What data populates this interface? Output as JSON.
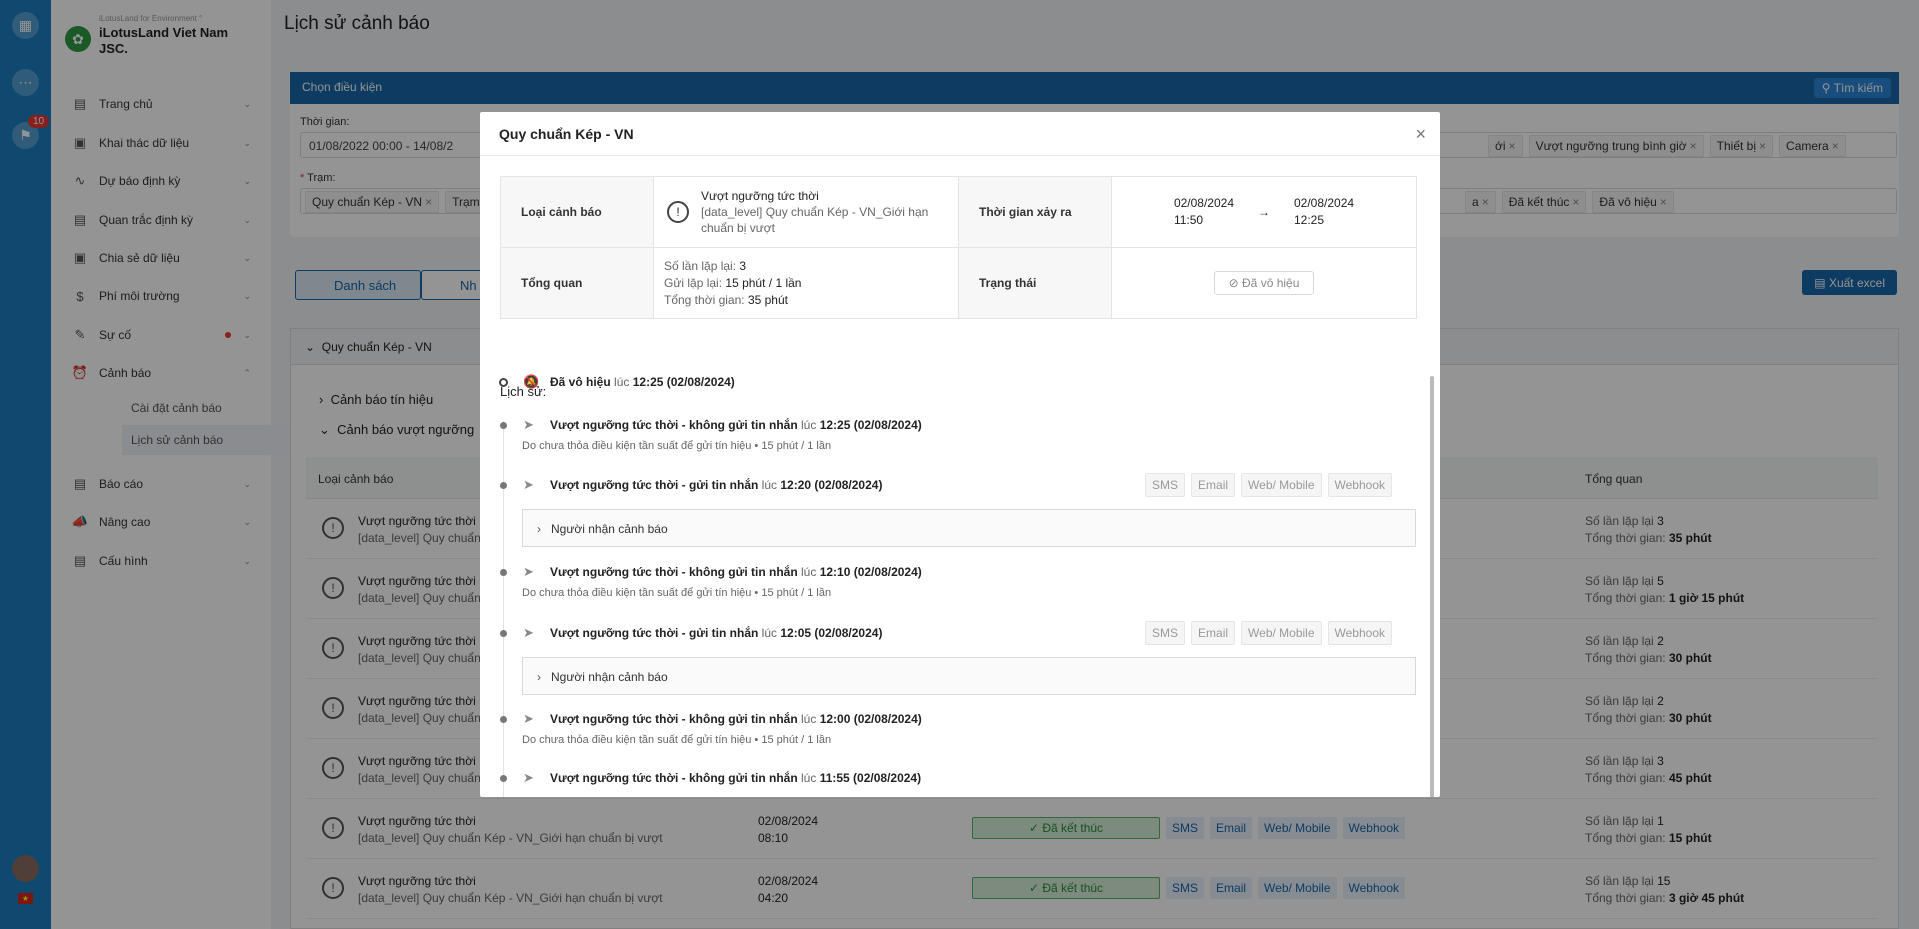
{
  "rail": {
    "badge": "10"
  },
  "brand": {
    "tagline": "iLotusLand for Environment °",
    "name": "iLotusLand Viet Nam JSC."
  },
  "nav": [
    {
      "label": "Trang chủ"
    },
    {
      "label": "Khai thác dữ liệu"
    },
    {
      "label": "Dự báo định kỳ"
    },
    {
      "label": "Quan trắc định kỳ"
    },
    {
      "label": "Chia sẻ dữ liệu"
    },
    {
      "label": "Phí môi trường"
    },
    {
      "label": "Sự cố"
    },
    {
      "label": "Cảnh báo"
    },
    {
      "label": "Báo cáo"
    },
    {
      "label": "Nâng cao"
    },
    {
      "label": "Cấu hình"
    }
  ],
  "subnav": {
    "settings": "Cài đặt cảnh báo",
    "history": "Lịch sử cảnh báo"
  },
  "page": {
    "title": "Lịch sử cảnh báo"
  },
  "filter": {
    "header": "Chọn điều kiện",
    "search": "Tìm kiếm",
    "time_label": "Thời gian:",
    "time_value": "01/08/2022 00:00 - 14/08/2",
    "station_label": "Trạm:",
    "type_tags": [
      "ới",
      "Vượt ngưỡng trung bình giờ",
      "Thiết bị",
      "Camera"
    ],
    "station_tags": [
      "Quy chuẩn Kép - VN",
      "Trạm"
    ],
    "status_tags": [
      "a",
      "Đã kết thúc",
      "Đã vô hiệu"
    ]
  },
  "tabs": {
    "list": "Danh sách",
    "other": "Nh"
  },
  "export": "Xuất excel",
  "group": {
    "title": "Quy chuẩn Kép - VN",
    "sec_signal": "Cảnh báo tín hiệu",
    "sec_threshold": "Cảnh báo vượt ngưỡng",
    "col_type": "Loại cảnh báo",
    "col_summary": "Tổng quan",
    "repeat_label": "Số lần lặp lại",
    "total_label": "Tổng thời gian:",
    "rows": [
      {
        "title": "Vượt ngưỡng tức thời",
        "desc": "[data_level] Quy chuẩn",
        "date": "",
        "time": "",
        "status": "",
        "repeat": "3",
        "total": "35 phút"
      },
      {
        "title": "Vượt ngưỡng tức thời",
        "desc": "[data_level] Quy chuẩn",
        "date": "",
        "time": "",
        "status": "",
        "repeat": "5",
        "total": "1 giờ 15 phút"
      },
      {
        "title": "Vượt ngưỡng tức thời",
        "desc": "[data_level] Quy chuẩn",
        "date": "",
        "time": "",
        "status": "",
        "repeat": "2",
        "total": "30 phút"
      },
      {
        "title": "Vượt ngưỡng tức thời",
        "desc": "[data_level] Quy chuẩn",
        "date": "",
        "time": "",
        "status": "",
        "repeat": "2",
        "total": "30 phút"
      },
      {
        "title": "Vượt ngưỡng tức thời",
        "desc": "[data_level] Quy chuẩn",
        "date": "",
        "time": "",
        "status": "",
        "repeat": "3",
        "total": "45 phút"
      },
      {
        "title": "Vượt ngưỡng tức thời",
        "desc": "[data_level] Quy chuẩn Kép - VN_Giới hạn chuẩn bị vượt",
        "date": "02/08/2024",
        "time": "08:10",
        "status": "✓ Đã kết thúc",
        "repeat": "1",
        "total": "15 phút"
      },
      {
        "title": "Vượt ngưỡng tức thời",
        "desc": "[data_level] Quy chuẩn Kép - VN_Giới hạn chuẩn bị vượt",
        "date": "02/08/2024",
        "time": "04:20",
        "status": "✓ Đã kết thúc",
        "repeat": "15",
        "total": "3 giờ 45 phút"
      }
    ]
  },
  "channels": [
    "SMS",
    "Email",
    "Web/ Mobile",
    "Webhook"
  ],
  "modal": {
    "title": "Quy chuẩn Kép - VN",
    "k_type": "Loại cảnh báo",
    "type_title": "Vượt ngưỡng tức thời",
    "type_desc": "[data_level] Quy chuẩn Kép - VN_Giới hạn chuẩn bị vượt",
    "k_time": "Thời gian xảy ra",
    "start_date": "02/08/2024",
    "start_time": "11:50",
    "end_date": "02/08/2024",
    "end_time": "12:25",
    "k_overview": "Tổng quan",
    "repeat_label": "Số lần lặp lại:",
    "repeat_value": "3",
    "resend_label": "Gửi lặp lại:",
    "resend_value": "15 phút / 1 lần",
    "total_label": "Tổng thời gian:",
    "total_value": "35 phút",
    "k_status": "Trạng thái",
    "status_value": "Đã vô hiệu",
    "history_label": "Lịch sử:",
    "receiver_label": "Người nhận cảnh báo",
    "at": "lúc",
    "events": [
      {
        "title": "Đã vô hiệu",
        "time": "12:25 (02/08/2024)",
        "note": "",
        "sent": false
      },
      {
        "title": "Vượt ngưỡng tức thời - không gửi tin nhắn",
        "time": "12:25 (02/08/2024)",
        "note": "Do chưa thỏa điều kiện tần suất để gửi tín hiệu • 15 phút / 1 lần",
        "sent": false
      },
      {
        "title": "Vượt ngưỡng tức thời - gửi tin nhắn",
        "time": "12:20 (02/08/2024)",
        "note": "",
        "sent": true
      },
      {
        "title": "Vượt ngưỡng tức thời - không gửi tin nhắn",
        "time": "12:10 (02/08/2024)",
        "note": "Do chưa thỏa điều kiện tần suất để gửi tín hiệu • 15 phút / 1 lần",
        "sent": false
      },
      {
        "title": "Vượt ngưỡng tức thời - gửi tin nhắn",
        "time": "12:05 (02/08/2024)",
        "note": "",
        "sent": true
      },
      {
        "title": "Vượt ngưỡng tức thời - không gửi tin nhắn",
        "time": "12:00 (02/08/2024)",
        "note": "Do chưa thỏa điều kiện tần suất để gửi tín hiệu • 15 phút / 1 lần",
        "sent": false
      },
      {
        "title": "Vượt ngưỡng tức thời - không gửi tin nhắn",
        "time": "11:55 (02/08/2024)",
        "note": "",
        "sent": false
      }
    ]
  },
  "colors": {
    "primary": "#1766a8",
    "rail": "#1a7fc1",
    "success": "#59b36a",
    "danger": "#e53935"
  }
}
